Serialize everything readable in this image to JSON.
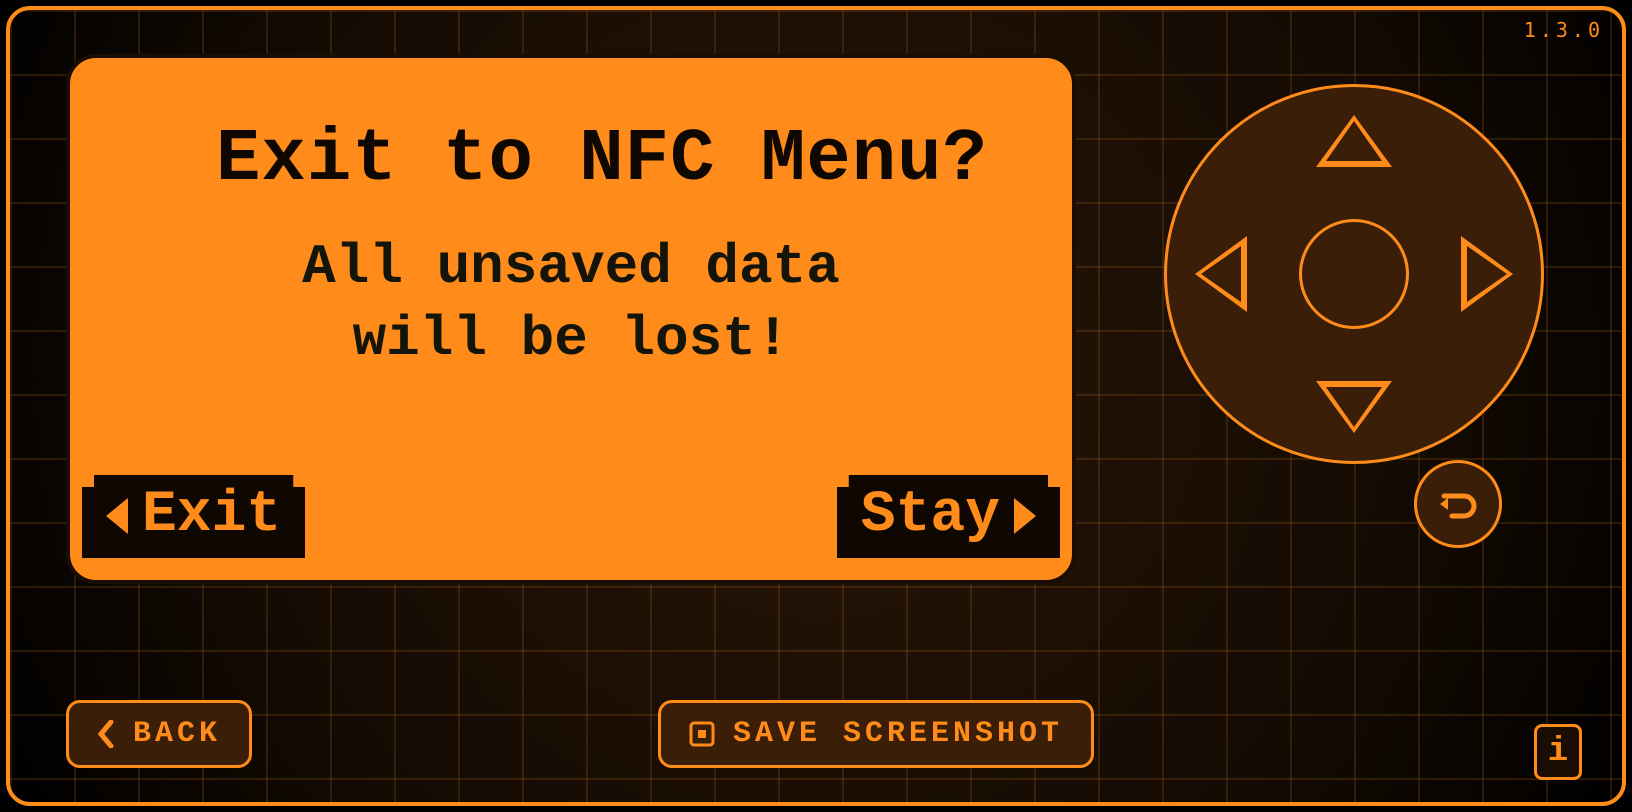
{
  "version": "1.3.0",
  "dialog": {
    "title": "Exit to NFC Menu?",
    "line1": "All unsaved data",
    "line2": "will be lost!",
    "exit_label": "Exit",
    "stay_label": "Stay"
  },
  "bottom": {
    "back_label": "BACK",
    "screenshot_label": "SAVE SCREENSHOT"
  },
  "info_label": "i",
  "colors": {
    "accent": "#ff8c1a",
    "panel_dark": "#3a1e07",
    "text_dark": "#0f0802"
  }
}
